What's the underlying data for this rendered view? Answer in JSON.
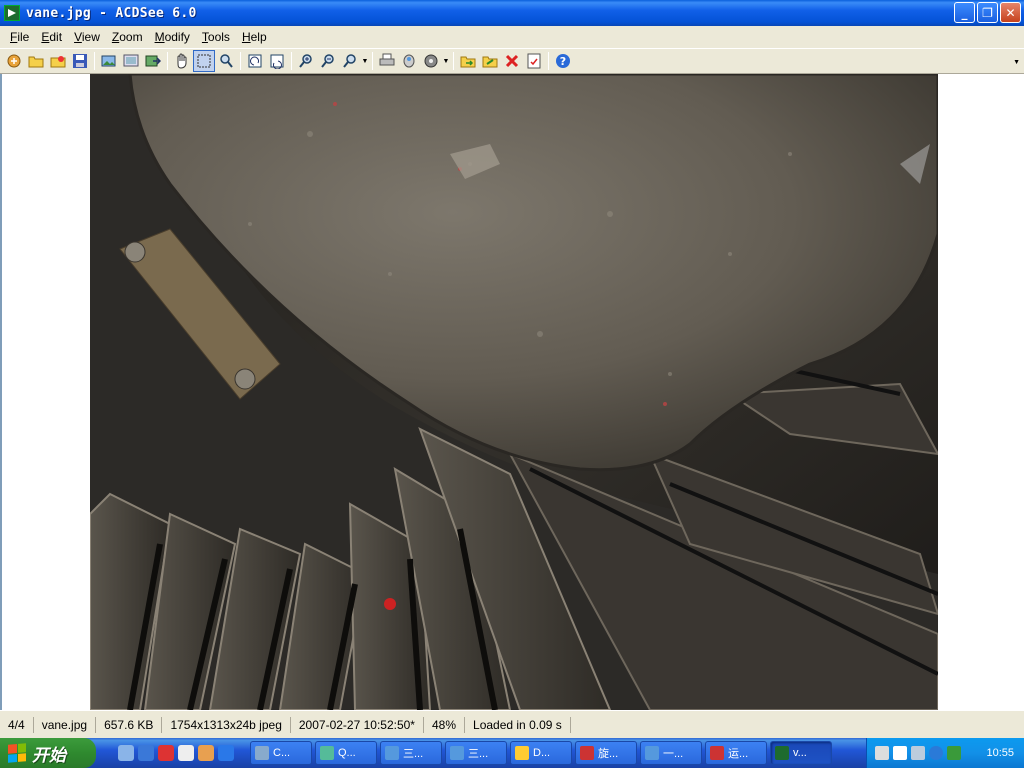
{
  "window": {
    "title": "vane.jpg - ACDSee 6.0",
    "buttons": {
      "minimize": "_",
      "maximize": "❐",
      "close": "✕"
    }
  },
  "menu": [
    {
      "label": "File",
      "key": "F",
      "rest": "ile"
    },
    {
      "label": "Edit",
      "key": "E",
      "rest": "dit"
    },
    {
      "label": "View",
      "key": "V",
      "rest": "iew"
    },
    {
      "label": "Zoom",
      "key": "Z",
      "rest": "oom"
    },
    {
      "label": "Modify",
      "key": "M",
      "rest": "odify"
    },
    {
      "label": "Tools",
      "key": "T",
      "rest": "ools"
    },
    {
      "label": "Help",
      "key": "H",
      "rest": "elp"
    }
  ],
  "toolbar": {
    "icons": [
      "browse-icon",
      "open-folder-icon",
      "open-file-icon",
      "save-icon",
      "acquire-icon",
      "slideshow-icon",
      "export-icon",
      "hand-tool-icon",
      "select-tool-icon",
      "magnifier-icon",
      "rotate-left-icon",
      "rotate-right-icon",
      "zoom-in-icon",
      "zoom-out-icon",
      "zoom-icon",
      "print-icon",
      "email-icon",
      "wallpaper-icon",
      "copy-to-icon",
      "move-to-icon",
      "delete-icon",
      "properties-icon",
      "help-icon"
    ]
  },
  "colors": {
    "accent": "#316ac5",
    "title_bar": "#0452d6",
    "start_green": "#2f8a2f"
  },
  "status": {
    "index": "4/4",
    "filename": "vane.jpg",
    "filesize": "657.6 KB",
    "dimensions": "1754x1313x24b jpeg",
    "datetime": "2007-02-27 10:52:50*",
    "zoom": "48%",
    "load": "Loaded in 0.09 s"
  },
  "taskbar": {
    "start_label": "开始",
    "tasks": [
      {
        "label": "C...",
        "color": "#8ac"
      },
      {
        "label": "Q...",
        "color": "#5b9"
      },
      {
        "label": "三...",
        "color": "#59d"
      },
      {
        "label": "三...",
        "color": "#59d"
      },
      {
        "label": "D...",
        "color": "#fc3"
      },
      {
        "label": "旋...",
        "color": "#c33"
      },
      {
        "label": "一...",
        "color": "#59d"
      },
      {
        "label": "运...",
        "color": "#c33"
      },
      {
        "label": "v...",
        "color": "#1e6b2e"
      }
    ],
    "clock": "10:55"
  }
}
